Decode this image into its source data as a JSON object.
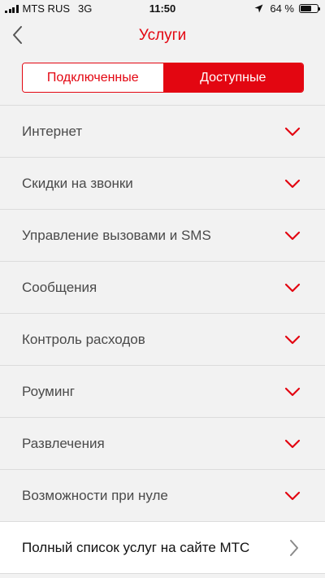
{
  "status": {
    "carrier": "MTS RUS",
    "network": "3G",
    "time": "11:50",
    "battery_text": "64 %",
    "battery_level": 0.64
  },
  "nav": {
    "title": "Услуги",
    "back_icon": "chevron-left-icon"
  },
  "tabs": [
    {
      "label": "Подключенные",
      "active": false
    },
    {
      "label": "Доступные",
      "active": true
    }
  ],
  "categories": [
    {
      "label": "Интернет"
    },
    {
      "label": "Скидки на звонки"
    },
    {
      "label": "Управление вызовами и SMS"
    },
    {
      "label": "Сообщения"
    },
    {
      "label": "Контроль расходов"
    },
    {
      "label": "Роуминг"
    },
    {
      "label": "Развлечения"
    },
    {
      "label": "Возможности при нуле"
    }
  ],
  "full_list_link": {
    "label": "Полный список услуг на сайте МТС"
  },
  "colors": {
    "accent": "#e30611",
    "background": "#f2f2f2",
    "text": "#4a4a4a"
  }
}
